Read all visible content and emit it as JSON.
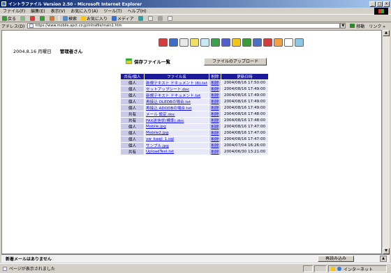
{
  "window": {
    "title": "イントラファイル Version 2.50 - Microsoft Internet Explorer",
    "buttons": [
      "_",
      "□",
      "×"
    ]
  },
  "menu": [
    "ファイル(F)",
    "編集(E)",
    "表示(V)",
    "お気に入り(A)",
    "ツール(T)",
    "ヘルプ(H)"
  ],
  "toolbar": {
    "back": "戻る",
    "search": "検索",
    "favorites": "お気に入り",
    "media": "メディア"
  },
  "address": {
    "label": "アドレス(D)",
    "url": "https://www.mobile.apct.co.jp/intrafile/main1.htm",
    "go": "移動",
    "links": "リンク »"
  },
  "page": {
    "date": "2004.8.16 月曜日",
    "user": "管理者さん",
    "title": "保存ファイル一覧",
    "upload_button": "ファイルのアップロード",
    "nav_icons": [
      "home-icon",
      "calendar-icon",
      "mail-icon",
      "notes-icon",
      "pencil-icon",
      "globe-icon",
      "disk-icon",
      "folder-icon",
      "book-icon",
      "chart-icon",
      "phone-icon",
      "edit-icon",
      "help-icon",
      "monitor-icon"
    ],
    "nav_icon_colors": [
      "#d43c3c",
      "#3a6ec8",
      "#e8e8e8",
      "#f0e060",
      "#c8e8f8",
      "#3aa04a",
      "#5060c8",
      "#f5c518",
      "#3a9a3a",
      "#4a70c8",
      "#d43c3c",
      "#f5a040",
      "#ffffff",
      "#88c8e8"
    ]
  },
  "table": {
    "headers": [
      "共有/個人",
      "ファイル名",
      "削除",
      "更新日時"
    ],
    "rows": [
      {
        "type": "個人",
        "name": "新規テキスト ドキュメント (6).txt",
        "del": "削除",
        "date": "2004/08/16 17:50:00"
      },
      {
        "type": "個人",
        "name": "セットアップシート.doc",
        "del": "削除",
        "date": "2004/08/16 17:49:00"
      },
      {
        "type": "個人",
        "name": "新規テキスト ドキュメント.txt",
        "del": "削除",
        "date": "2004/08/16 17:49:00"
      },
      {
        "type": "個人",
        "name": "再接込 OLEDBの場合.txt",
        "del": "削除",
        "date": "2004/08/16 17:49:00"
      },
      {
        "type": "個人",
        "name": "再接込 ADODBの場合.txt",
        "del": "削除",
        "date": "2004/08/16 17:49:00"
      },
      {
        "type": "共有",
        "name": "メール 設定.doc",
        "del": "削除",
        "date": "2004/08/16 17:48:00"
      },
      {
        "type": "共有",
        "name": "FAX送信状(標準).doc",
        "del": "削除",
        "date": "2004/08/16 17:48:00"
      },
      {
        "type": "個人",
        "name": "Mobile.jpg",
        "del": "削除",
        "date": "2004/08/16 17:47:00"
      },
      {
        "type": "個人",
        "name": "Mobile2.jpg",
        "del": "削除",
        "date": "2004/08/16 17:47:00"
      },
      {
        "type": "個人",
        "name": "vw_kaaji_1.sql",
        "del": "削除",
        "date": "2004/08/16 17:47:00"
      },
      {
        "type": "個人",
        "name": "サンプル.jpg",
        "del": "削除",
        "date": "2004/07/04 16:26:00"
      },
      {
        "type": "共有",
        "name": "UploadTest.txt",
        "del": "削除",
        "date": "2004/06/30 13:21:00"
      }
    ]
  },
  "notice": {
    "text": "新着メールはありません",
    "reload": "再読み込み"
  },
  "status": {
    "text": "ページが表示されました",
    "zone": "インターネット"
  }
}
